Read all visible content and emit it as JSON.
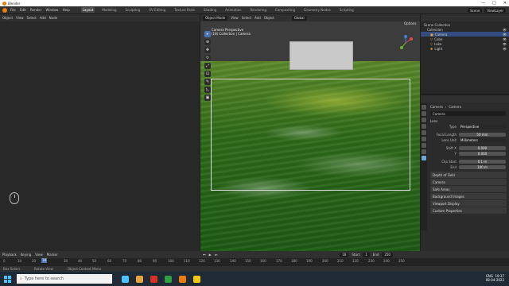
{
  "window": {
    "title": "Blender",
    "controls": [
      "—",
      "□",
      "✕"
    ]
  },
  "topbar": {
    "menus": [
      "File",
      "Edit",
      "Render",
      "Window",
      "Help"
    ],
    "workspaces": [
      "Layout",
      "Modeling",
      "Sculpting",
      "UV Editing",
      "Texture Paint",
      "Shading",
      "Animation",
      "Rendering",
      "Compositing",
      "Geometry Nodes",
      "Scripting"
    ],
    "active_workspace": "Layout",
    "scene": "Scene",
    "view_layer": "ViewLayer"
  },
  "left_editor": {
    "header": [
      "Object",
      "View",
      "Select",
      "Add",
      "Node"
    ],
    "footer": [
      "Playback",
      "Keying",
      "View",
      "Marker"
    ]
  },
  "viewport": {
    "header": [
      "Object Mode",
      "View",
      "Select",
      "Add",
      "Object"
    ],
    "transform": "Global",
    "overlay_line1": "Camera Perspective",
    "overlay_line2": "(18) Collection | Camera",
    "options": "Options",
    "tools": [
      "▸",
      "⊕",
      "✥",
      "↻",
      "⤢",
      "⊡",
      "✎",
      "◺",
      "▣"
    ]
  },
  "outliner": {
    "root": "Scene Collection",
    "items": [
      {
        "name": "Collection",
        "selected": false
      },
      {
        "name": "Camera",
        "selected": true
      },
      {
        "name": "Cube",
        "selected": false
      },
      {
        "name": "Lake",
        "selected": false
      },
      {
        "name": "Light",
        "selected": false
      }
    ]
  },
  "properties": {
    "breadcrumb": [
      "Camera",
      "Camera"
    ],
    "data_name": "Camera",
    "section": "Lens",
    "rows": [
      {
        "label": "Type",
        "value": "Perspective"
      },
      {
        "label": "Focal Length",
        "value": "50 mm"
      },
      {
        "label": "Lens Unit",
        "value": "Millimeters"
      },
      {
        "label": "Shift X",
        "value": "0.000"
      },
      {
        "label": "Y",
        "value": "0.000"
      },
      {
        "label": "Clip Start",
        "value": "0.1 m"
      },
      {
        "label": "End",
        "value": "100 m"
      }
    ],
    "panels": [
      "Depth of Field",
      "Camera",
      "Safe Areas",
      "Background Images",
      "Viewport Display",
      "Custom Properties"
    ]
  },
  "timeline": {
    "current_frame": "18",
    "start_label": "Start",
    "start": "1",
    "end_label": "End",
    "end": "250",
    "ticks": [
      "0",
      "10",
      "20",
      "30",
      "40",
      "50",
      "60",
      "70",
      "80",
      "90",
      "100",
      "110",
      "120",
      "130",
      "140",
      "150",
      "160",
      "170",
      "180",
      "190",
      "200",
      "210",
      "220",
      "230",
      "240",
      "250"
    ]
  },
  "statusbar": [
    "Box Select",
    "Rotate View",
    "Object Context Menu"
  ],
  "taskbar": {
    "search_placeholder": "Type here to search",
    "time": "19:37",
    "date": "08-04-2022",
    "lang": "ENG",
    "icon_colors": [
      "#4cc2ff",
      "#e8a33d",
      "#d93025",
      "#2ea043",
      "#e87d0d",
      "#f2c811"
    ]
  }
}
